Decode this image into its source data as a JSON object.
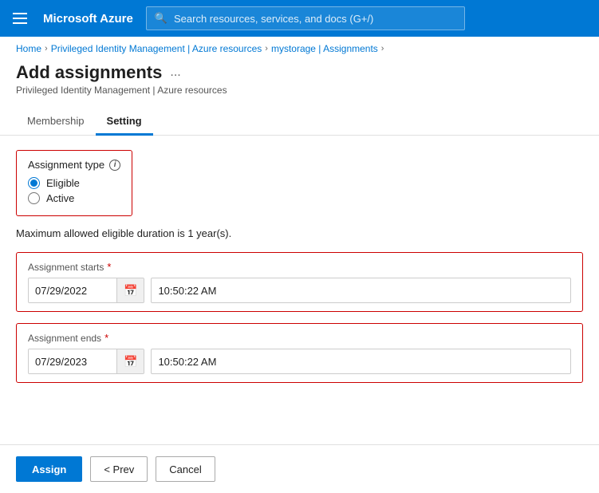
{
  "topbar": {
    "logo": "Microsoft Azure",
    "search_placeholder": "Search resources, services, and docs (G+/)"
  },
  "breadcrumb": {
    "home": "Home",
    "pim": "Privileged Identity Management | Azure resources",
    "assignments": "mystorage | Assignments"
  },
  "page": {
    "title": "Add assignments",
    "subtitle": "Privileged Identity Management | Azure resources",
    "ellipsis": "..."
  },
  "tabs": [
    {
      "label": "Membership",
      "active": false
    },
    {
      "label": "Setting",
      "active": true
    }
  ],
  "form": {
    "assignment_type_label": "Assignment type",
    "eligible_label": "Eligible",
    "active_label": "Active",
    "info_message": "Maximum allowed eligible duration is 1 year(s).",
    "starts_label": "Assignment starts",
    "ends_label": "Assignment ends",
    "starts_date": "07/29/2022",
    "starts_time": "10:50:22 AM",
    "ends_date": "07/29/2023",
    "ends_time": "10:50:22 AM"
  },
  "footer": {
    "assign_label": "Assign",
    "prev_label": "< Prev",
    "cancel_label": "Cancel"
  }
}
